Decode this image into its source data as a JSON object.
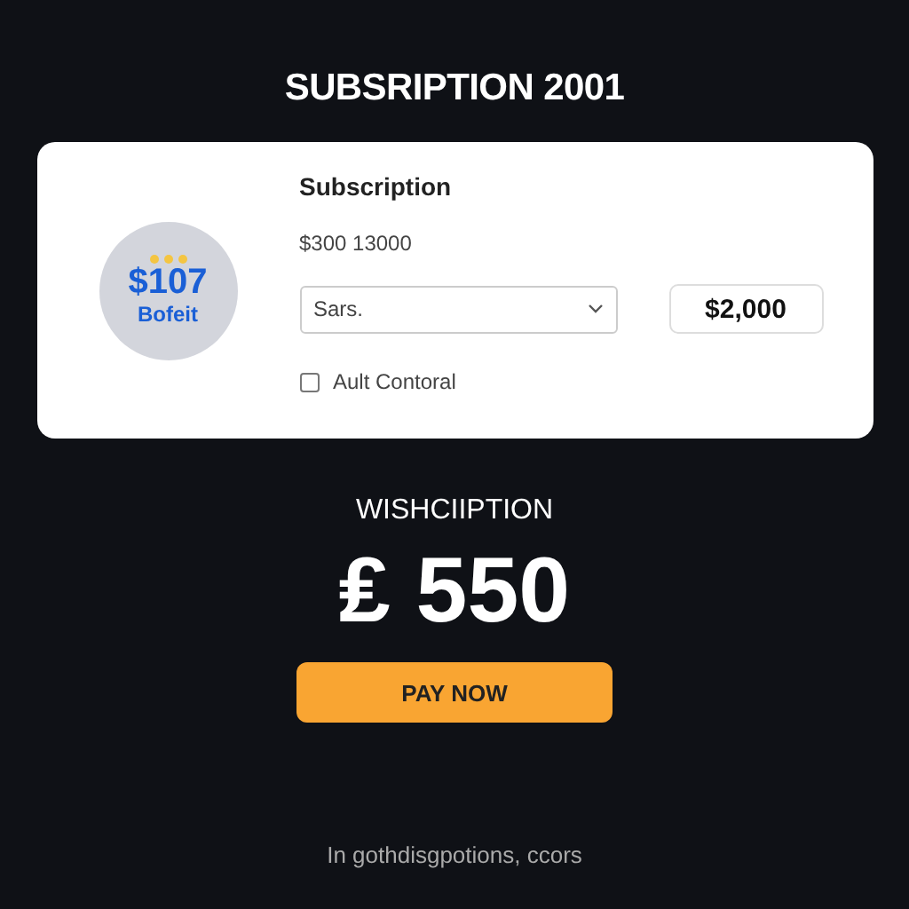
{
  "page_title": "SUBSRIPTION 2001",
  "card": {
    "badge": {
      "amount": "$107",
      "label": "Bofeit"
    },
    "title": "Subscription",
    "subtitle": "$300 13000",
    "select": {
      "value": "Sars."
    },
    "price_button": "$2,000",
    "checkbox": {
      "label": "Ault Contoral",
      "checked": false
    }
  },
  "summary": {
    "label": "WISHCIIPTION",
    "amount": "₤ 550",
    "button": "PAY NOW"
  },
  "footer": "In gothdisgpotions, ccors"
}
